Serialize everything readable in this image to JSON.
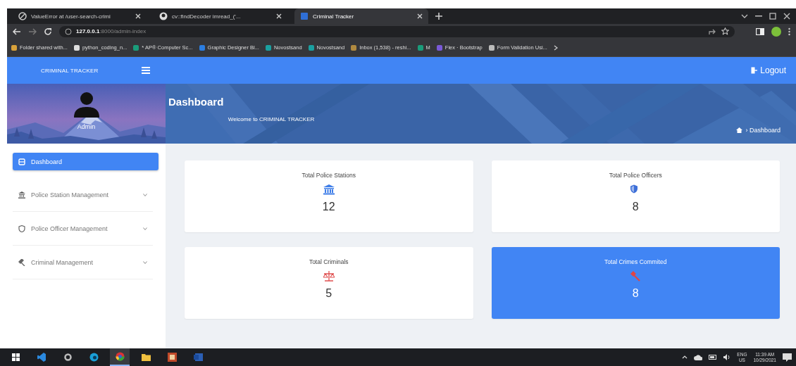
{
  "browser": {
    "tabs": [
      {
        "title": "ValueError at /user-search-crimi",
        "selected": false
      },
      {
        "title": "cv::findDecoder imread_('...",
        "selected": false
      },
      {
        "title": "Criminal Tracker",
        "selected": true
      }
    ],
    "address": {
      "host": "127.0.0.1",
      "path": ":8000/admin-index"
    },
    "bookmarks": [
      "Folder shared with...",
      "python_coding_n...",
      "* AP® Computer Sc...",
      "Graphic Designer Bl...",
      "Novostsand",
      "Novostsand",
      "Inbox (1,538) - reshi...",
      "M",
      "Flex · Bootstrap",
      "Form Validation Usi..."
    ]
  },
  "header": {
    "brand": "CRIMINAL TRACKER",
    "logout": "Logout"
  },
  "profile": {
    "name": "Admin"
  },
  "banner": {
    "title": "Dashboard",
    "welcome": "Welcome to CRIMINAL TRACKER",
    "breadcrumb": "› Dashboard"
  },
  "sidebar": {
    "items": [
      {
        "label": "Dashboard",
        "selected": true,
        "expandable": false
      },
      {
        "label": "Police Station Management",
        "selected": false,
        "expandable": true
      },
      {
        "label": "Police Officer Management",
        "selected": false,
        "expandable": true
      },
      {
        "label": "Criminal Management",
        "selected": false,
        "expandable": true
      }
    ]
  },
  "cards": [
    {
      "title": "Total Police Stations",
      "value": "12",
      "highlighted": false
    },
    {
      "title": "Total Police Officers",
      "value": "8",
      "highlighted": false
    },
    {
      "title": "Total Criminals",
      "value": "5",
      "highlighted": false
    },
    {
      "title": "Total Crimes Commited",
      "value": "8",
      "highlighted": true
    }
  ],
  "taskbar": {
    "language": "ENG",
    "region": "US",
    "time": "11:39 AM",
    "date": "10/29/2021"
  }
}
